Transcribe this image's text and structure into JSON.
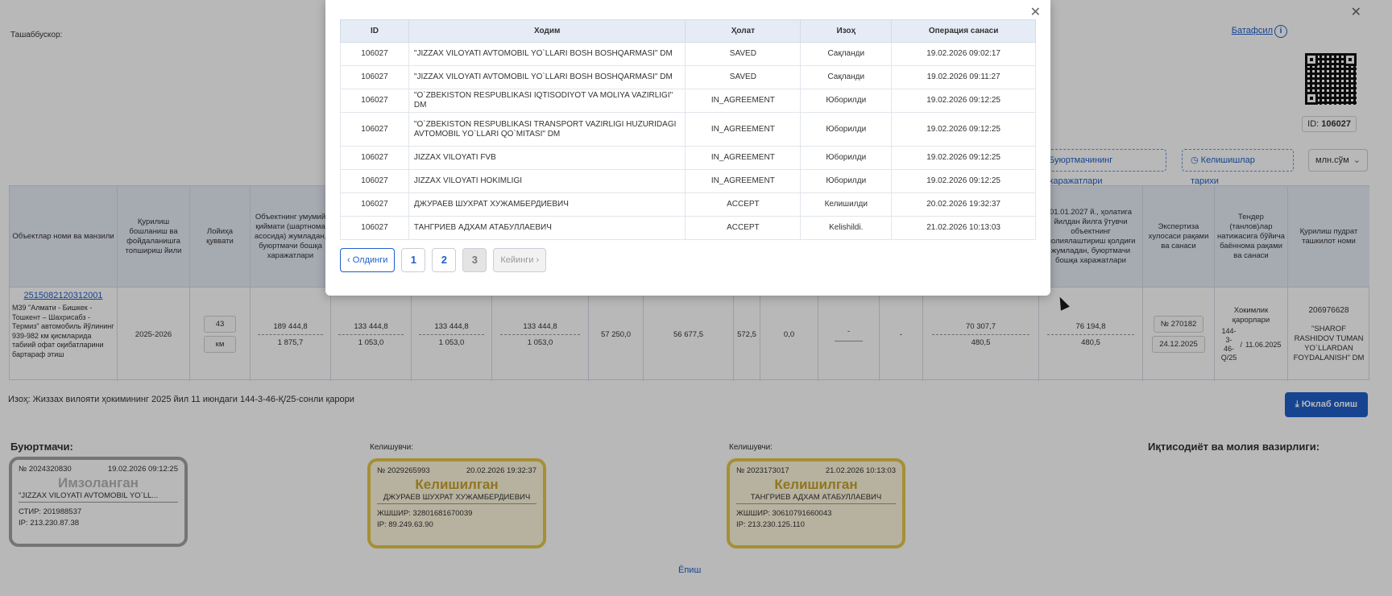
{
  "page": {
    "initiator_label": "Ташаббускор:",
    "details_link": "Батафсил",
    "id_label": "ID:",
    "id_value": "106027",
    "btn_customer_costs": "Буюртмачининг харажатлари",
    "btn_agreement_history": "Келишишлар тарихи",
    "unit_select": "млн.сўм",
    "note_label": "Изоҳ:",
    "note_text": "Жиззах вилояти ҳокимининг 2025 йил 11 июндаги 144-3-46-Қ/25-сонли қарори",
    "download_button": "Юклаб олиш",
    "exit_link": "Ёпиш"
  },
  "main_table": {
    "headers": [
      "Объектлар номи ва манзили",
      "Қурилиш бошланиш ва фойдаланишга топшириш йили",
      "Лойиҳа қуввати",
      "Объектнинг умумий қиймати (шартнома асосида) жумладан, буюртмачи бошқа харажатлари",
      "",
      "",
      "",
      "",
      "",
      "",
      "",
      "",
      "",
      "01.01.2027 й., ҳолатига йилдан йилга ўтувчи объектнинг молиялаштириш қолдиғи жумладан, буюртмачи бошқа харажатлари",
      "Экспертиза хулосаси рақами ва санаси",
      "Тендер (танлов)лар натижасига бўйича баённома рақами ва санаси",
      "Қурилиш пудрат ташкилот номи"
    ],
    "row": {
      "object_link": "2515082120312001",
      "object_desc": "М39 \"Алмати - Бишкек - Тошкент – Шахрисабз - Термиз\" автомобиль йўлининг 939-982 км қисмларида табиий офат оқибатларини бартараф этиш",
      "years": "2025-2026",
      "capacity": "43",
      "capacity_unit": "км",
      "c1_top": "189 444,8",
      "c1_bot": "1 875,7",
      "c2_top": "133 444,8",
      "c2_bot": "1 053,0",
      "c3_top": "133 444,8",
      "c3_bot": "1 053,0",
      "c4_top": "133 444,8",
      "c4_bot": "1 053,0",
      "c5": "57 250,0",
      "c6": "56 677,5",
      "c7": "572,5",
      "c8": "0,0",
      "c9": "-",
      "c10": "-",
      "c11_top": "70 307,7",
      "c11_bot": "480,5",
      "c12_top": "76 194,8",
      "c12_bot": "480,5",
      "expert_no": "№ 270182",
      "expert_date": "24.12.2025",
      "tender_a": "Хокимлик қарорлари",
      "tender_b": "144-3-46-Q/25",
      "tender_sep": "/",
      "tender_date": "11.06.2025",
      "contractor_inn": "206976628",
      "contractor_name": "\"SHAROF RASHIDOV TUMAN YO`LLARDAN FOYDALANISH\" DM"
    }
  },
  "signatures": {
    "customer_label": "Буюртмачи:",
    "agreer_label": "Келишувчи:",
    "ministry_label": "Иқтисодиёт ва молия вазирлиги:",
    "stamps": [
      {
        "no": "№ 2024320830",
        "date": "19.02.2026 09:12:25",
        "status": "Имзоланган",
        "name": "\"JIZZAX VILOYATI AVTOMOBIL YO`LL...",
        "l1": "СТИР: 201988537",
        "l2": "IP: 213.230.87.38"
      },
      {
        "no": "№ 2029265993",
        "date": "20.02.2026 19:32:37",
        "status": "Келишилган",
        "name": "ДЖУРАЕВ ШУХРАТ ХУЖАМБЕРДИЕВИЧ",
        "l1": "ЖШШИР: 32801681670039",
        "l2": "IP: 89.249.63.90"
      },
      {
        "no": "№ 2023173017",
        "date": "21.02.2026 10:13:03",
        "status": "Келишилган",
        "name": "ТАНГРИЕВ АДХАМ АТАБУЛЛАЕВИЧ",
        "l1": "ЖШШИР: 30610791660043",
        "l2": "IP: 213.230.125.110"
      }
    ]
  },
  "modal": {
    "headers": [
      "ID",
      "Ходим",
      "Ҳолат",
      "Изоҳ",
      "Операция санаси"
    ],
    "rows": [
      {
        "id": "106027",
        "employee": "\"JIZZAX VILOYATI AVTOMOBIL YO`LLARI BOSH BOSHQARMASI\" DM",
        "status": "SAVED",
        "note": "Сақланди",
        "date": "19.02.2026 09:02:17"
      },
      {
        "id": "106027",
        "employee": "\"JIZZAX VILOYATI AVTOMOBIL YO`LLARI BOSH BOSHQARMASI\" DM",
        "status": "SAVED",
        "note": "Сақланди",
        "date": "19.02.2026 09:11:27"
      },
      {
        "id": "106027",
        "employee": "\"O`ZBEKISTON RESPUBLIKASI IQTISODIYOT VA MOLIYA VAZIRLIGI\" DM",
        "status": "IN_AGREEMENT",
        "note": "Юборилди",
        "date": "19.02.2026 09:12:25"
      },
      {
        "id": "106027",
        "employee": "\"O`ZBEKISTON RESPUBLIKASI TRANSPORT VAZIRLIGI HUZURIDAGI AVTOMOBIL YO`LLARI QO`MITASI\" DM",
        "status": "IN_AGREEMENT",
        "note": "Юборилди",
        "date": "19.02.2026 09:12:25"
      },
      {
        "id": "106027",
        "employee": "JIZZAX VILOYATI FVB",
        "status": "IN_AGREEMENT",
        "note": "Юборилди",
        "date": "19.02.2026 09:12:25"
      },
      {
        "id": "106027",
        "employee": "JIZZAX VILOYATI HOKIMLIGI",
        "status": "IN_AGREEMENT",
        "note": "Юборилди",
        "date": "19.02.2026 09:12:25"
      },
      {
        "id": "106027",
        "employee": "ДЖУРАЕВ ШУХРАТ ХУЖАМБЕРДИЕВИЧ",
        "status": "ACCEPT",
        "note": "Келишилди",
        "date": "20.02.2026 19:32:37"
      },
      {
        "id": "106027",
        "employee": "ТАНГРИЕВ АДХАМ АТАБУЛЛАЕВИЧ",
        "status": "ACCEPT",
        "note": "Kelishildi.",
        "date": "21.02.2026 10:13:03"
      }
    ],
    "pager": {
      "prev": "Олдинги",
      "p1": "1",
      "p2": "2",
      "p3": "3",
      "next": "Кейинги"
    }
  }
}
